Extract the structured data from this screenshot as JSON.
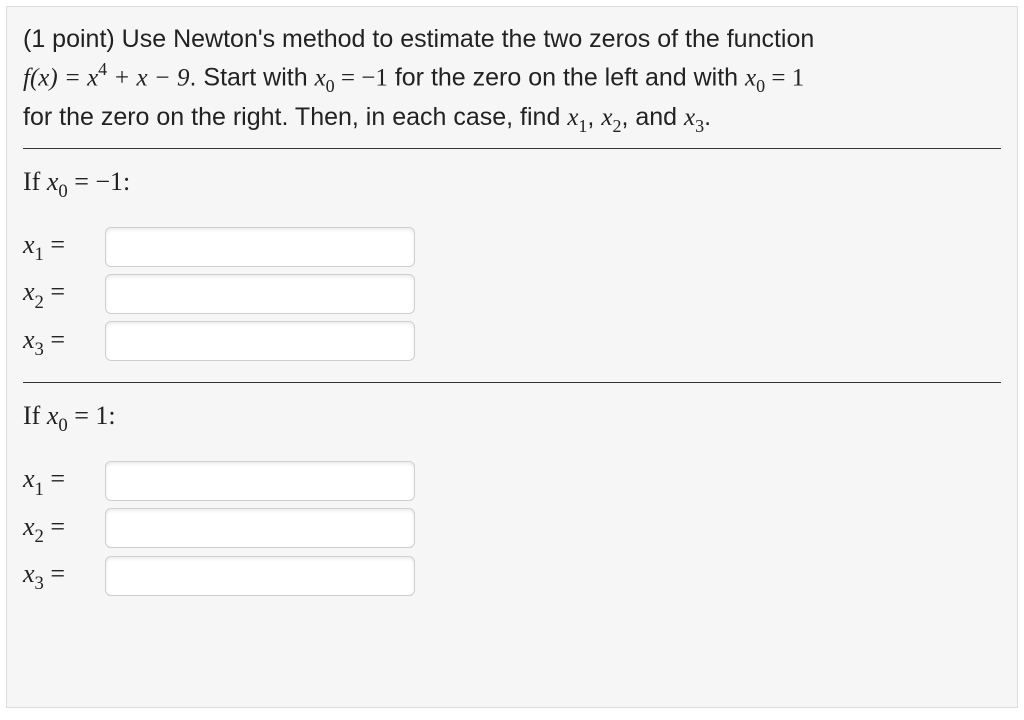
{
  "problem": {
    "points_prefix": "(1 point) ",
    "intro": "Use Newton's method to estimate the two zeros of the function",
    "fn_lhs": "f(x) = x",
    "fn_exp": "4",
    "fn_rhs": " + x − 9",
    "start_lead": ". Start with ",
    "x0_expr_a": "x",
    "x0_sub": "0",
    "eq_neg1": " = −1",
    "mid": " for the zero on the left and with ",
    "eq_1": " = 1",
    "tail1": "for the zero on the right. Then, in each case, find ",
    "x1_sub": "1",
    "comma_sep": ", ",
    "x2_sub": "2",
    "and_sep": ", and ",
    "x3_sub": "3",
    "period": "."
  },
  "section_a": {
    "if_text": "If ",
    "x_label": "x",
    "sub0": "0",
    "eq_val": " = −1:",
    "rows": [
      {
        "label_var": "x",
        "label_sub": "1",
        "label_eq": " = ",
        "value": ""
      },
      {
        "label_var": "x",
        "label_sub": "2",
        "label_eq": " = ",
        "value": ""
      },
      {
        "label_var": "x",
        "label_sub": "3",
        "label_eq": " = ",
        "value": ""
      }
    ]
  },
  "section_b": {
    "if_text": "If ",
    "x_label": "x",
    "sub0": "0",
    "eq_val": " = 1:",
    "rows": [
      {
        "label_var": "x",
        "label_sub": "1",
        "label_eq": " = ",
        "value": ""
      },
      {
        "label_var": "x",
        "label_sub": "2",
        "label_eq": " = ",
        "value": ""
      },
      {
        "label_var": "x",
        "label_sub": "3",
        "label_eq": " = ",
        "value": ""
      }
    ]
  }
}
